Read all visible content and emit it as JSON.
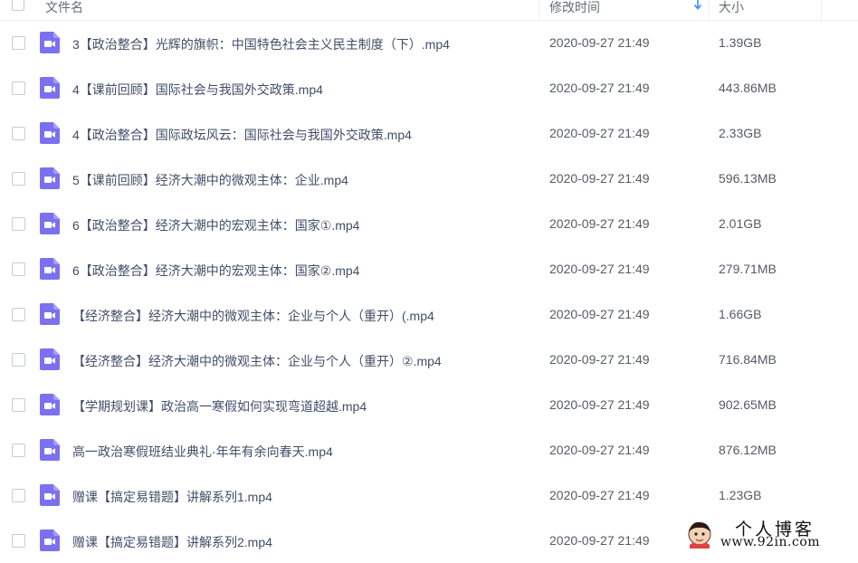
{
  "header": {
    "col_name": "文件名",
    "col_modified": "修改时间",
    "col_size": "大小"
  },
  "files": [
    {
      "name": "3【政治整合】光辉的旗帜：中国特色社会主义民主制度（下）.mp4",
      "date": "2020-09-27 21:49",
      "size": "1.39GB"
    },
    {
      "name": "4【课前回顾】国际社会与我国外交政策.mp4",
      "date": "2020-09-27 21:49",
      "size": "443.86MB"
    },
    {
      "name": "4【政治整合】国际政坛风云：国际社会与我国外交政策.mp4",
      "date": "2020-09-27 21:49",
      "size": "2.33GB"
    },
    {
      "name": "5【课前回顾】经济大潮中的微观主体：企业.mp4",
      "date": "2020-09-27 21:49",
      "size": "596.13MB"
    },
    {
      "name": "6【政治整合】经济大潮中的宏观主体：国家①.mp4",
      "date": "2020-09-27 21:49",
      "size": "2.01GB"
    },
    {
      "name": "6【政治整合】经济大潮中的宏观主体：国家②.mp4",
      "date": "2020-09-27 21:49",
      "size": "279.71MB"
    },
    {
      "name": "【经济整合】经济大潮中的微观主体：企业与个人（重开）(.mp4",
      "date": "2020-09-27 21:49",
      "size": "1.66GB"
    },
    {
      "name": "【经济整合】经济大潮中的微观主体：企业与个人（重开）②.mp4",
      "date": "2020-09-27 21:49",
      "size": "716.84MB"
    },
    {
      "name": "【学期规划课】政治高一寒假如何实现弯道超越.mp4",
      "date": "2020-09-27 21:49",
      "size": "902.65MB"
    },
    {
      "name": "高一政治寒假班结业典礼·年年有余向春天.mp4",
      "date": "2020-09-27 21:49",
      "size": "876.12MB"
    },
    {
      "name": "赠课【搞定易错题】讲解系列1.mp4",
      "date": "2020-09-27 21:49",
      "size": "1.23GB"
    },
    {
      "name": "赠课【搞定易错题】讲解系列2.mp4",
      "date": "2020-09-27 21:49",
      "size": ""
    }
  ],
  "watermark": {
    "title": "个人博客",
    "url": "www.92in.com"
  },
  "colors": {
    "video_icon": "#7b70ef",
    "sort_arrow": "#3c8cf0"
  },
  "icons": {
    "file_type": "video-file-icon",
    "sort": "sort-down-icon"
  }
}
